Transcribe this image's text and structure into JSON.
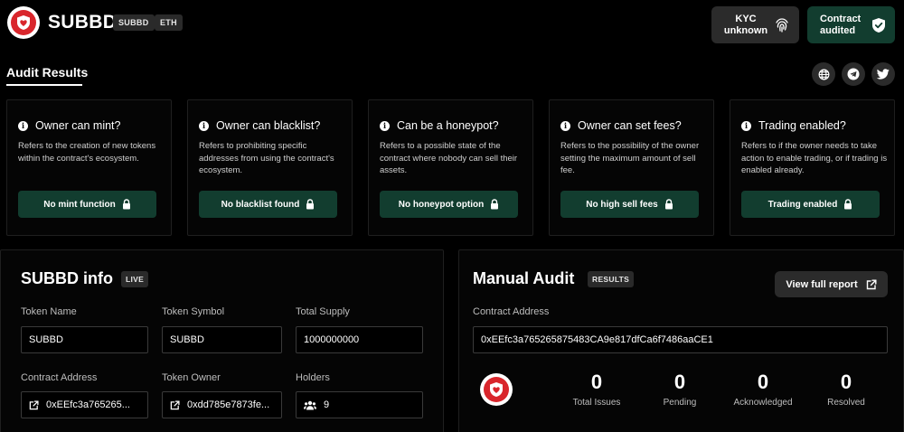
{
  "header": {
    "brand": "SUBBD",
    "tags": [
      "SUBBD",
      "ETH"
    ],
    "kyc_label": "KYC unknown",
    "audited_label": "Contract audited"
  },
  "tabs": {
    "active": "Audit Results"
  },
  "checks": [
    {
      "title": "Owner can mint?",
      "desc": "Refers to the creation of new tokens within the contract's ecosystem.",
      "result": "No mint function"
    },
    {
      "title": "Owner can blacklist?",
      "desc": "Refers to prohibiting specific addresses from using the contract's ecosystem.",
      "result": "No blacklist found"
    },
    {
      "title": "Can be a honeypot?",
      "desc": "Refers to a possible state of the contract where nobody can sell their assets.",
      "result": "No honeypot option"
    },
    {
      "title": "Owner can set fees?",
      "desc": "Refers to the possibility of the owner setting the maximum amount of sell fee.",
      "result": "No high sell fees"
    },
    {
      "title": "Trading enabled?",
      "desc": "Refers to if the owner needs to take action to enable trading, or if trading is enabled already.",
      "result": "Trading enabled"
    }
  ],
  "info": {
    "title": "SUBBD info",
    "badge": "LIVE",
    "token_name_label": "Token Name",
    "token_name": "SUBBD",
    "token_symbol_label": "Token Symbol",
    "token_symbol": "SUBBD",
    "total_supply_label": "Total Supply",
    "total_supply": "1000000000",
    "contract_address_label": "Contract Address",
    "contract_address": "0xEEfc3a765265...",
    "token_owner_label": "Token Owner",
    "token_owner": "0xdd785e7873fe...",
    "holders_label": "Holders",
    "holders": "9"
  },
  "manual": {
    "title": "Manual Audit",
    "badge": "RESULTS",
    "report_label": "View full report",
    "contract_address_label": "Contract Address",
    "contract_address": "0xEEfc3a765265875483CA9e817dfCa6f7486aaCE1",
    "stats": [
      {
        "value": "0",
        "label": "Total Issues"
      },
      {
        "value": "0",
        "label": "Pending"
      },
      {
        "value": "0",
        "label": "Acknowledged"
      },
      {
        "value": "0",
        "label": "Resolved"
      }
    ]
  },
  "icons": {
    "brand": "shield-heart-icon",
    "kyc": "fingerprint-icon",
    "audited": "shield-check-icon",
    "socials": [
      "globe-icon",
      "telegram-icon",
      "twitter-icon"
    ]
  },
  "colors": {
    "accent_green": "#123d2f",
    "brand_red": "#d9262c"
  }
}
